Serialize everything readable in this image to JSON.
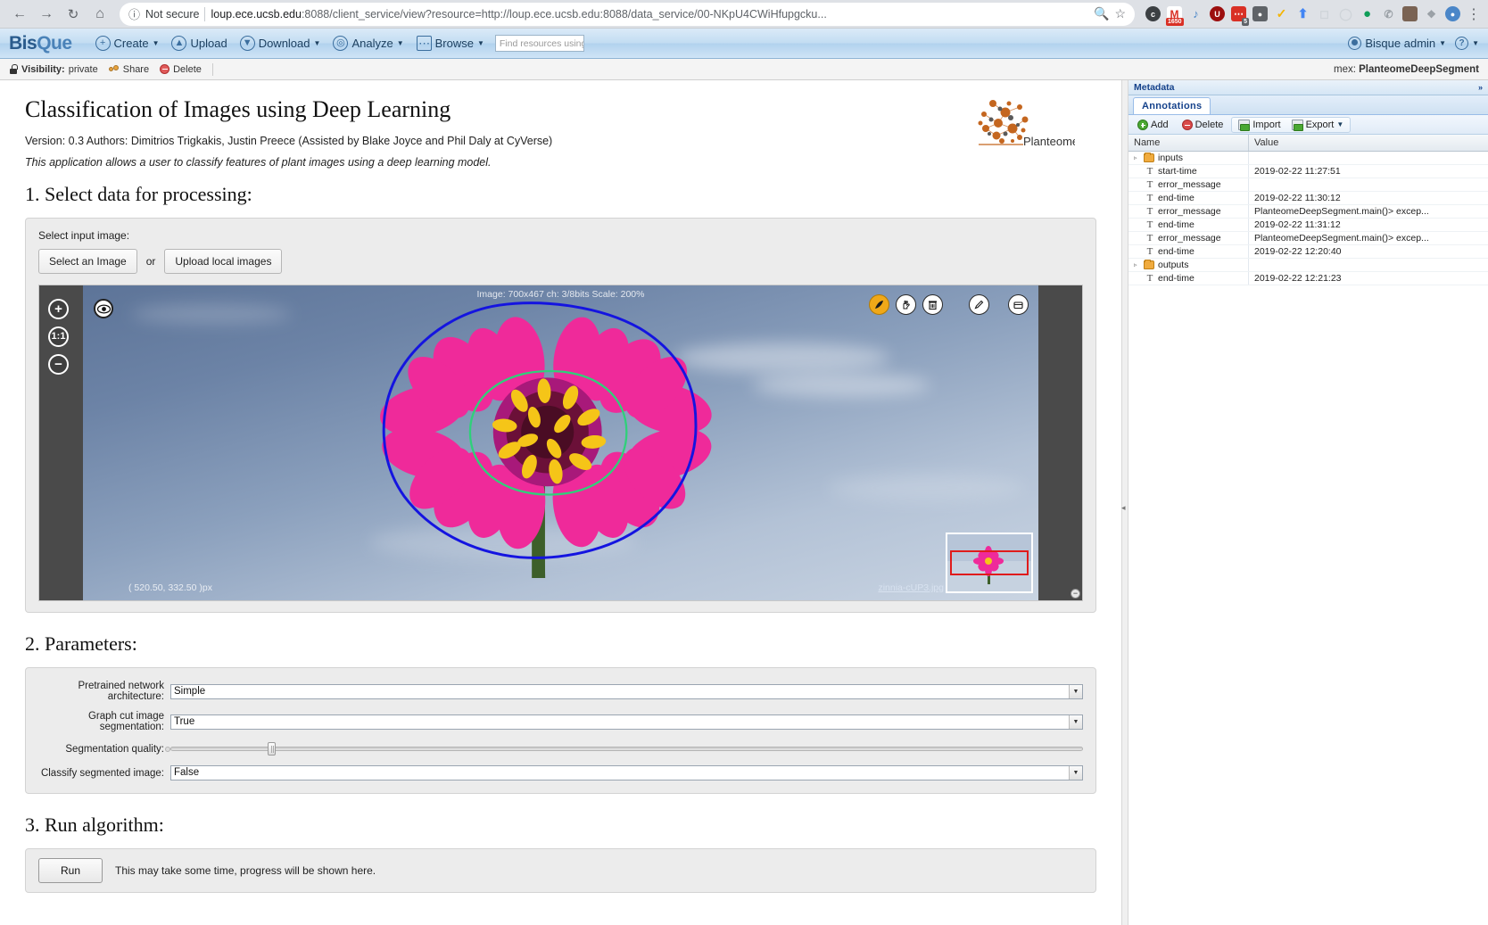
{
  "browser": {
    "back_icon": "arrow-left-icon",
    "forward_icon": "arrow-right-icon",
    "reload_icon": "reload-icon",
    "home_icon": "home-icon",
    "info_icon": "info-circle-icon",
    "security_label": "Not secure",
    "url_domain": "loup.ece.ucsb.edu",
    "url_rest": ":8088/client_service/view?resource=http://loup.ece.ucsb.edu:8088/data_service/00-NKpU4CWiHfupgcku...",
    "search_icon": "search-icon",
    "bookmark_icon": "star-icon",
    "extensions": [
      {
        "name": "cc-extension-icon",
        "glyph": "c⁺",
        "bg": "#3c4043",
        "round": true
      },
      {
        "name": "gmail-extension-icon",
        "glyph": "M",
        "bg": "#ffffff",
        "badge": "1650"
      },
      {
        "name": "volume-extension-icon",
        "glyph": "⧖",
        "bg": "#4a86c8",
        "round": false
      },
      {
        "name": "ublock-extension-icon",
        "glyph": "U",
        "bg": "#9c0f0f",
        "round": true
      },
      {
        "name": "notes-extension-icon",
        "glyph": "⋯",
        "bg": "#d93025",
        "badge_dark": "5"
      },
      {
        "name": "lightbulb-extension-icon",
        "glyph": "◯",
        "bg": "#5f6368"
      },
      {
        "name": "checkmark-extension-icon",
        "glyph": "✓",
        "bg": "#f4b400"
      },
      {
        "name": "arrow-up-extension-icon",
        "glyph": "⬆",
        "bg": "#4285f4"
      },
      {
        "name": "chat-extension-icon",
        "glyph": "□",
        "bg": "#ffffff"
      },
      {
        "name": "circle-extension-icon",
        "glyph": "◯",
        "bg": "#ffffff"
      },
      {
        "name": "green-pin-extension-icon",
        "glyph": "●",
        "bg": "#0f9d58"
      },
      {
        "name": "whatsapp-extension-icon",
        "glyph": "✆",
        "bg": "#ffffff"
      },
      {
        "name": "profile-photo-icon",
        "glyph": "●",
        "bg": "#8a6d5a"
      },
      {
        "name": "puzzle-extension-icon",
        "glyph": "❖",
        "bg": "#9aa0a6"
      }
    ],
    "profile_icon": "user-avatar-icon",
    "menu_icon": "kebab-menu-icon"
  },
  "app_header": {
    "logo_bis": "Bis",
    "logo_que": "Que",
    "menu": [
      {
        "label": "Create",
        "icon": "plus-circle-icon",
        "glyph": "+",
        "caret": true
      },
      {
        "label": "Upload",
        "icon": "upload-circle-icon",
        "glyph": "⬆",
        "caret": false
      },
      {
        "label": "Download",
        "icon": "download-circle-icon",
        "glyph": "⬇",
        "caret": true
      },
      {
        "label": "Analyze",
        "icon": "analyze-circle-icon",
        "glyph": "●",
        "caret": true
      },
      {
        "label": "Browse",
        "icon": "grid-icon",
        "glyph": "∷",
        "caret": true
      }
    ],
    "search_placeholder": "Find resources using tags",
    "user_label": "Bisque admin",
    "user_caret": "▾",
    "help_label": "?",
    "avatar_icon": "user-circle-icon",
    "help_icon": "help-circle-icon"
  },
  "toolbar": {
    "lock_icon": "lock-icon",
    "visibility_key": "Visibility:",
    "visibility_value": "private",
    "share_icon": "share-people-icon",
    "share_label": "Share",
    "delete_icon": "delete-circle-icon",
    "delete_label": "Delete",
    "mex_key": "mex:",
    "mex_value": "PlanteomeDeepSegment"
  },
  "main": {
    "title": "Classification of Images using Deep Learning",
    "version_line": "Version: 0.3 Authors: Dimitrios Trigkakis, Justin Preece (Assisted by Blake Joyce and Phil Daly at CyVerse)",
    "description": "This application allows a user to classify features of plant images using a deep learning model.",
    "logo_text": "Planteome",
    "section1_title": "1. Select data for processing:",
    "select_input_label": "Select input image:",
    "select_image_button": "Select an Image",
    "or_text": "or",
    "upload_button": "Upload local images",
    "section2_title": "2. Parameters:",
    "section3_title": "3. Run algorithm:",
    "run_button": "Run",
    "run_message": "This may take some time, progress will be shown here."
  },
  "viewer": {
    "zoom_in_icon": "zoom-in-icon",
    "zoom_in_glyph": "+",
    "zoom_reset_label": "1:1",
    "zoom_out_icon": "zoom-out-icon",
    "zoom_out_glyph": "−",
    "eye_icon": "eye-visibility-icon",
    "info_text": "Image: 700x467 ch: 3/8bits Scale: 200%",
    "tools": [
      {
        "name": "polygon-tool-icon",
        "glyph": "✒",
        "active": true
      },
      {
        "name": "move-hand-tool-icon",
        "glyph": "☚",
        "active": false
      },
      {
        "name": "trash-tool-icon",
        "glyph": "Ὕ1",
        "active": false
      },
      {
        "name": "edit-pencil-tool-icon",
        "glyph": "✎",
        "active": false
      },
      {
        "name": "layers-tool-icon",
        "glyph": "◑",
        "active": false
      }
    ],
    "coords": "(  520.50,   332.50 )px",
    "filename": "zinnia-cUP3.jpg",
    "thumbnail_minimize": "−"
  },
  "parameters": [
    {
      "label": "Pretrained network architecture:",
      "type": "select",
      "value": "Simple"
    },
    {
      "label": "Graph cut image segmentation:",
      "type": "select",
      "value": "True"
    },
    {
      "label": "Segmentation quality:",
      "type": "slider",
      "value": "11"
    },
    {
      "label": "Classify segmented image:",
      "type": "select",
      "value": "False"
    }
  ],
  "metadata": {
    "panel_title": "Metadata",
    "collapse_icon": "collapse-right-icon",
    "tab_label": "Annotations",
    "toolbar": {
      "add_label": "Add",
      "delete_label": "Delete",
      "import_label": "Import",
      "export_label": "Export",
      "export_caret": "▾"
    },
    "columns": [
      "Name",
      "Value"
    ],
    "rows": [
      {
        "type": "folder",
        "name": "inputs",
        "value": "",
        "expander": "▹"
      },
      {
        "type": "text",
        "name": "start-time",
        "value": "2019-02-22 11:27:51"
      },
      {
        "type": "text",
        "name": "error_message",
        "value": ""
      },
      {
        "type": "text",
        "name": "end-time",
        "value": "2019-02-22 11:30:12"
      },
      {
        "type": "text",
        "name": "error_message",
        "value": "PlanteomeDeepSegment.main()> excep..."
      },
      {
        "type": "text",
        "name": "end-time",
        "value": "2019-02-22 11:31:12"
      },
      {
        "type": "text",
        "name": "error_message",
        "value": "PlanteomeDeepSegment.main()> excep..."
      },
      {
        "type": "text",
        "name": "end-time",
        "value": "2019-02-22 12:20:40"
      },
      {
        "type": "folder",
        "name": "outputs",
        "value": "",
        "expander": "▹"
      },
      {
        "type": "text",
        "name": "end-time",
        "value": "2019-02-22 12:21:23"
      }
    ]
  },
  "colors": {
    "accent_blue": "#15428b",
    "brand_orange": "#c4661f",
    "annotation_blue": "#1414e0",
    "annotation_green": "#2fd07a",
    "flower_pink": "#ef2a9a"
  }
}
